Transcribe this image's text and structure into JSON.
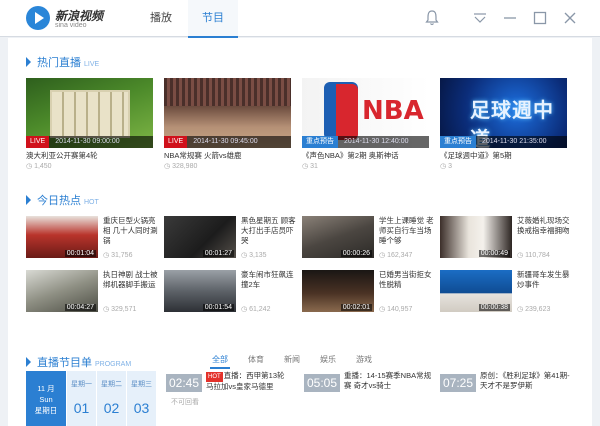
{
  "app": {
    "name_cn": "新浪视频",
    "name_en": "sina video"
  },
  "nav": {
    "tabs": [
      {
        "label": "播放"
      },
      {
        "label": "节目"
      }
    ]
  },
  "colors": {
    "accent": "#2b7fd2",
    "live_tag": "#d0111b",
    "hot_badge": "#e3322b"
  },
  "live_section": {
    "title_cn": "热门直播",
    "title_en": "LIVE",
    "items": [
      {
        "tag": "LIVE",
        "time": "2014-11-30 09:00:00",
        "title": "澳大利亚公开赛第4轮",
        "count": "1,450"
      },
      {
        "tag": "LIVE",
        "time": "2014-11-30 09:45:00",
        "title": "NBA常规赛 火箭vs雄鹿",
        "count": "328,980"
      },
      {
        "tag": "重点预告",
        "time": "2014-11-30 12:40:00",
        "title": "《声色NBA》第2期 奥斯神话",
        "count": "31"
      },
      {
        "tag": "重点预告",
        "time": "2014-11-30 21:35:00",
        "title": "《足球週中道》第5期",
        "count": "3"
      }
    ]
  },
  "hot_section": {
    "title_cn": "今日热点",
    "title_en": "HOT",
    "items": [
      {
        "title": "重庆巨型火锅亮相 几十人同时涮锅",
        "duration": "00:01:04",
        "count": "31,756"
      },
      {
        "title": "黑色星期五 顾客大打出手店员吓哭",
        "duration": "00:01:27",
        "count": "3,135"
      },
      {
        "title": "学生上课睡觉 老师买自行车当场睡个够",
        "duration": "00:00:26",
        "count": "162,347"
      },
      {
        "title": "艾薇婚礼现场交换戒指幸福拥吻",
        "duration": "00:00:49",
        "count": "110,784"
      },
      {
        "title": "执日神剧 战士被绑机器脚手搬运",
        "duration": "00:04:27",
        "count": "329,571"
      },
      {
        "title": "豪车闹市狂飙连撞2车",
        "duration": "00:01:54",
        "count": "61,242"
      },
      {
        "title": "已婚男当街拒女性脱精",
        "duration": "00:02:01",
        "count": "140,957"
      },
      {
        "title": "新疆哥车发生暴炒事件",
        "duration": "00:00:38",
        "count": "239,623"
      }
    ]
  },
  "program_section": {
    "title_cn": "直播节目单",
    "title_en": "PROGRAM",
    "filters": [
      {
        "label": "全部"
      },
      {
        "label": "体育"
      },
      {
        "label": "新闻"
      },
      {
        "label": "娱乐"
      },
      {
        "label": "游戏"
      }
    ],
    "date": {
      "month": "11 月",
      "weekday_en": "Sun",
      "weekday_cn": "星期日"
    },
    "days": [
      {
        "weekday": "星期一",
        "day": "01"
      },
      {
        "weekday": "星期二",
        "day": "02"
      },
      {
        "weekday": "星期三",
        "day": "03"
      }
    ],
    "items": [
      {
        "time": "02:45",
        "badge": "HOT",
        "title": "直播：西甲第13轮 马拉加vs皇家马德里",
        "note": "不可回看"
      },
      {
        "time": "05:05",
        "badge": "",
        "title": "重播：14-15赛季NBA常规赛 奇才vs骑士",
        "note": ""
      },
      {
        "time": "07:25",
        "badge": "",
        "title": "原创：《胜利足球》第41期-天才不是罗伊斯",
        "note": ""
      }
    ]
  }
}
